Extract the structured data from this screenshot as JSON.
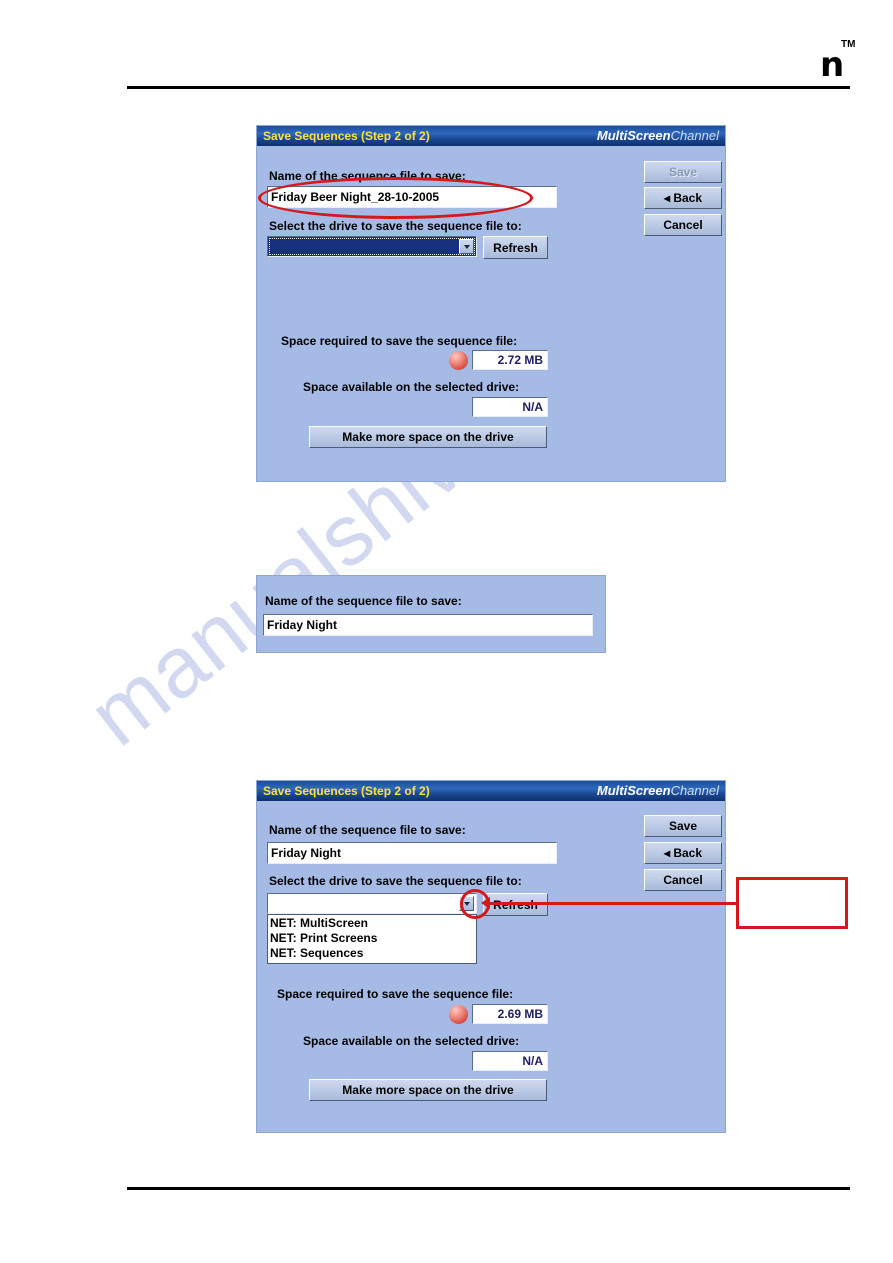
{
  "page": {
    "logo_mark": "n",
    "logo_tm": "TM",
    "watermark": "manualshive.com"
  },
  "dialog_top": {
    "titlebar": {
      "title": "Save Sequences (Step 2 of 2)",
      "brand_bold": "MultiScreen",
      "brand_light": "Channel"
    },
    "name_label": "Name of the sequence file to save:",
    "name_value": "Friday Beer Night_28-10-2005",
    "drive_label": "Select the drive to save the sequence file to:",
    "drive_value": "",
    "refresh_label": "Refresh",
    "space_required_label": "Space required to save the sequence file:",
    "space_required_value": "2.72 MB",
    "space_available_label": "Space available on the selected drive:",
    "space_available_value": "N/A",
    "make_space_label": "Make more space on the drive",
    "buttons": {
      "save": "Save",
      "back": "◂ Back",
      "cancel": "Cancel"
    }
  },
  "panel_middle": {
    "name_label": "Name of the sequence file to save:",
    "name_value": "Friday Night"
  },
  "dialog_bottom": {
    "titlebar": {
      "title": "Save Sequences (Step 2 of 2)",
      "brand_bold": "MultiScreen",
      "brand_light": "Channel"
    },
    "name_label": "Name of the sequence file to save:",
    "name_value": "Friday Night",
    "drive_label": "Select the drive to save the sequence file to:",
    "drive_value": "",
    "refresh_label": "Refresh",
    "drive_options": [
      "NET: MultiScreen",
      "NET: Print Screens",
      "NET: Sequences"
    ],
    "space_required_label": "Space required to save the sequence file:",
    "space_required_value": "2.69 MB",
    "space_available_label": "Space available on the selected drive:",
    "space_available_value": "N/A",
    "make_space_label": "Make more space on the drive",
    "buttons": {
      "save": "Save",
      "back": "◂ Back",
      "cancel": "Cancel"
    }
  },
  "annotations": {
    "callout_text": "",
    "accent_color": "#d4181c"
  }
}
